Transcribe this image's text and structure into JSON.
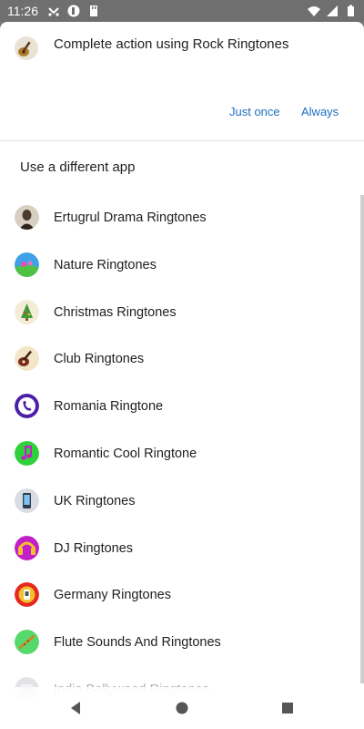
{
  "status": {
    "time": "11:26"
  },
  "dialog": {
    "title": "Complete action using Rock Ringtones",
    "just_once": "Just once",
    "always": "Always",
    "section_label": "Use a different app"
  },
  "apps": [
    {
      "label": "Ertugrul Drama Ringtones",
      "icon": "ertugrul-icon",
      "color": "#4a3b2c"
    },
    {
      "label": "Nature Ringtones",
      "icon": "nature-icon",
      "color": "#3fa1e8"
    },
    {
      "label": "Christmas Ringtones",
      "icon": "christmas-icon",
      "color": "#e8d7a0"
    },
    {
      "label": "Club Ringtones",
      "icon": "guitar-icon",
      "color": "#f2e6c8"
    },
    {
      "label": "Romania Ringtone",
      "icon": "phone-icon",
      "color": "#4b1fa6"
    },
    {
      "label": "Romantic Cool Ringtone",
      "icon": "music-note-icon",
      "color": "#2fd13a"
    },
    {
      "label": "UK Ringtones",
      "icon": "mobile-phone-icon",
      "color": "#d9dde3"
    },
    {
      "label": "DJ Ringtones",
      "icon": "dj-icon",
      "color": "#c21ec9"
    },
    {
      "label": "Germany Ringtones",
      "icon": "germany-icon",
      "color": "#e6281e"
    },
    {
      "label": "Flute Sounds And Ringtones",
      "icon": "flute-icon",
      "color": "#57d86a"
    },
    {
      "label": "India Bollywood Ringtones",
      "icon": "bollywood-icon",
      "color": "#aab0b8"
    }
  ]
}
